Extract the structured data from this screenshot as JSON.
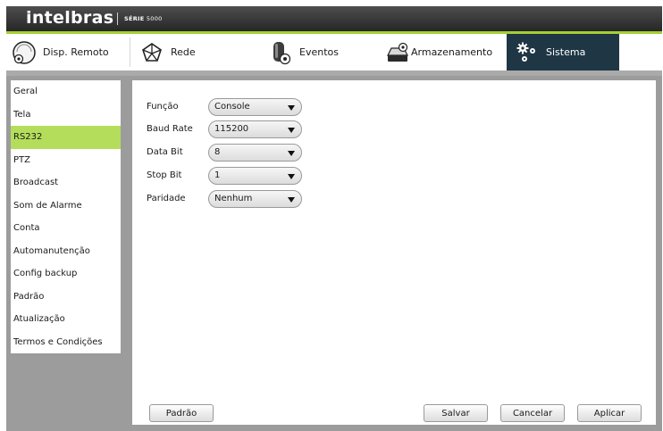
{
  "brand": {
    "logo": "intelbras",
    "series_prefix": "SÉRIE",
    "series_number": "5000"
  },
  "tabs": [
    {
      "label": "Disp. Remoto",
      "icon": "remote-device-icon",
      "active": false
    },
    {
      "label": "Rede",
      "icon": "network-icon",
      "active": false
    },
    {
      "label": "Eventos",
      "icon": "events-icon",
      "active": false
    },
    {
      "label": "Armazenamento",
      "icon": "storage-icon",
      "active": false
    },
    {
      "label": "Sistema",
      "icon": "system-gears-icon",
      "active": true
    }
  ],
  "sidebar": {
    "items": [
      {
        "label": "Geral",
        "active": false
      },
      {
        "label": "Tela",
        "active": false
      },
      {
        "label": "RS232",
        "active": true
      },
      {
        "label": "PTZ",
        "active": false
      },
      {
        "label": "Broadcast",
        "active": false
      },
      {
        "label": "Som de Alarme",
        "active": false
      },
      {
        "label": "Conta",
        "active": false
      },
      {
        "label": "Automanutenção",
        "active": false
      },
      {
        "label": "Config backup",
        "active": false
      },
      {
        "label": "Padrão",
        "active": false
      },
      {
        "label": "Atualização",
        "active": false
      },
      {
        "label": "Termos e Condições",
        "active": false
      }
    ]
  },
  "form": {
    "fields": [
      {
        "label": "Função",
        "value": "Console"
      },
      {
        "label": "Baud Rate",
        "value": "115200"
      },
      {
        "label": "Data Bit",
        "value": "8"
      },
      {
        "label": "Stop Bit",
        "value": "1"
      },
      {
        "label": "Paridade",
        "value": "Nenhum"
      }
    ]
  },
  "buttons": {
    "default": "Padrão",
    "save": "Salvar",
    "cancel": "Cancelar",
    "apply": "Aplicar"
  },
  "colors": {
    "accent_green": "#a6cf34",
    "active_tab": "#1f3645",
    "selected_item": "#b4dd5b",
    "background_gray": "#9c9c9c"
  }
}
